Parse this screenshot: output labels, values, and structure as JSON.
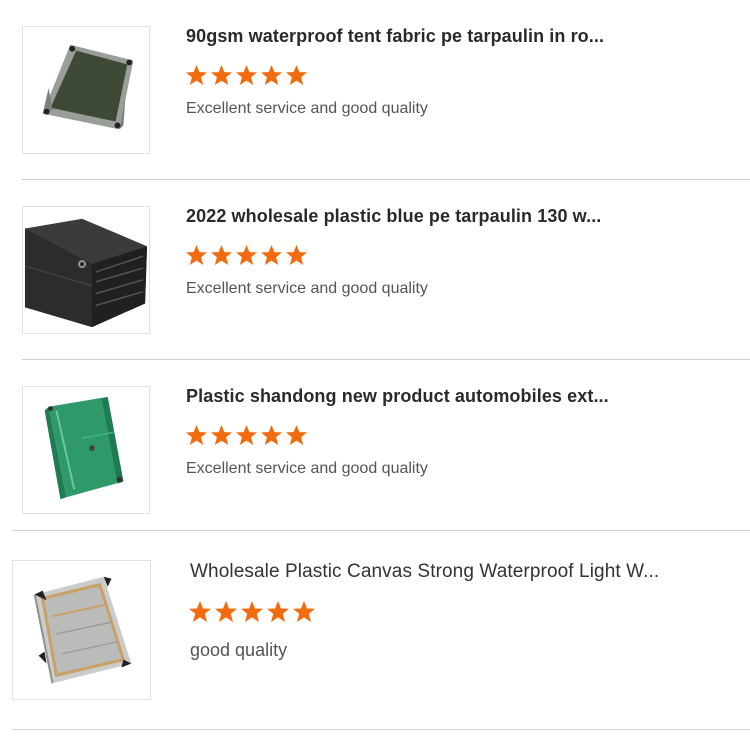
{
  "colors": {
    "star": "#f26b0f",
    "divider": "#cfcfcf",
    "title": "#2a2a2a",
    "review": "#555555"
  },
  "products": [
    {
      "title": "90gsm waterproof tent fabric pe tarpaulin in ro...",
      "rating": 5,
      "review": "Excellent service and good quality",
      "thumbnail_icon": "green-gray-tarpaulin-image"
    },
    {
      "title": "2022 wholesale plastic blue pe tarpaulin 130 w...",
      "rating": 5,
      "review": "Excellent service and good quality",
      "thumbnail_icon": "black-rolled-tarpaulin-image"
    },
    {
      "title": "Plastic shandong new product automobiles ext...",
      "rating": 5,
      "review": "Excellent service and good quality",
      "thumbnail_icon": "green-tarpaulin-image"
    },
    {
      "title": "Wholesale Plastic Canvas Strong Waterproof Light W...",
      "rating": 5,
      "review": "good quality",
      "thumbnail_icon": "clear-mesh-tarpaulin-image"
    }
  ]
}
